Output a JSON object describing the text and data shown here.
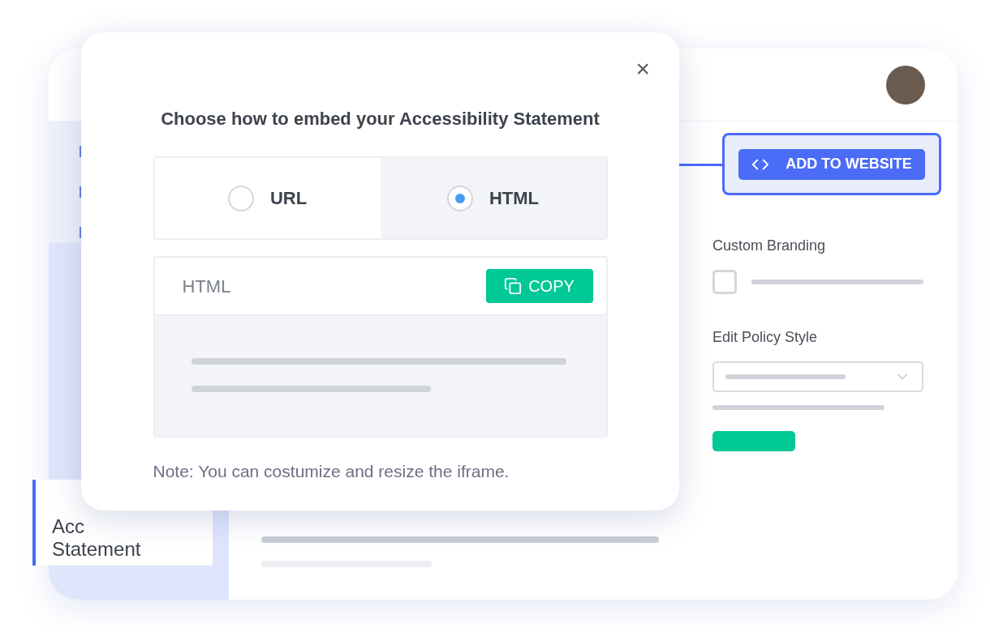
{
  "sidebar": {
    "active_item": {
      "lines": [
        "Acc",
        "Statement"
      ]
    }
  },
  "add_button": {
    "label": "ADD TO WEBSITE"
  },
  "settings": {
    "branding_label": "Custom Branding",
    "branding_checked": false,
    "style_label": "Edit Policy Style"
  },
  "modal": {
    "close": "×",
    "title": "Choose how to embed your Accessibility Statement",
    "options": [
      {
        "label": "URL",
        "selected": false
      },
      {
        "label": "HTML",
        "selected": true
      }
    ],
    "code_panel": {
      "label": "HTML",
      "copy_button": "COPY"
    },
    "note": "Note: You can costumize and resize the iframe."
  }
}
